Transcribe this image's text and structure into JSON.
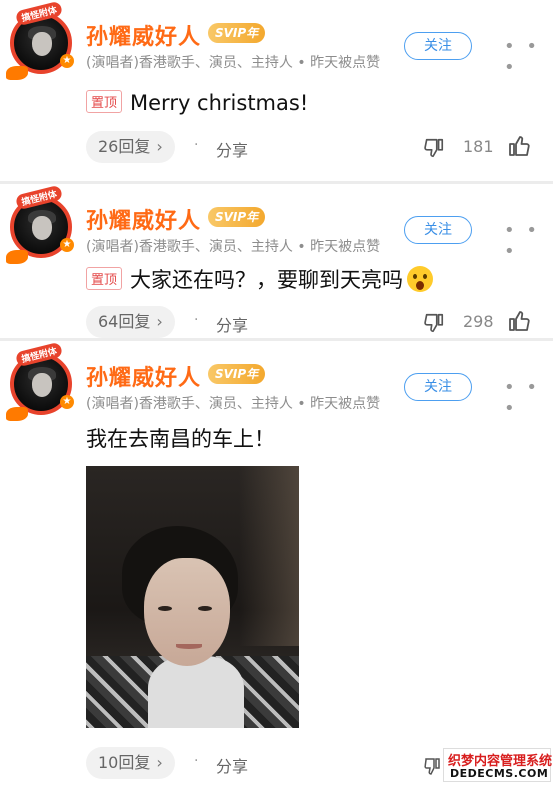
{
  "posts": [
    {
      "avatar_ribbon": "搞怪附体",
      "name": "孙耀威好人",
      "vip_badge": "SVIP年",
      "meta": "(演唱者)香港歌手、演员、主持人 • 昨天被点赞",
      "follow_label": "关注",
      "more_label": "• • •",
      "pin_label": "置顶",
      "text": "Merry christmas!",
      "reply_label": "26回复",
      "share_label": "分享",
      "like_count": "181"
    },
    {
      "avatar_ribbon": "搞怪附体",
      "name": "孙耀威好人",
      "vip_badge": "SVIP年",
      "meta": "(演唱者)香港歌手、演员、主持人 • 昨天被点赞",
      "follow_label": "关注",
      "more_label": "• • •",
      "pin_label": "置顶",
      "text": "大家还在吗？，要聊到天亮吗",
      "emoji": "surprised-face-emoji",
      "reply_label": "64回复",
      "share_label": "分享",
      "like_count": "298"
    },
    {
      "avatar_ribbon": "搞怪附体",
      "name": "孙耀威好人",
      "vip_badge": "SVIP年",
      "meta": "(演唱者)香港歌手、演员、主持人 • 昨天被点赞",
      "follow_label": "关注",
      "more_label": "• • •",
      "text": "我在去南昌的车上！",
      "image": "selfie-photo",
      "reply_label": "10回复",
      "share_label": "分享"
    }
  ],
  "watermark": {
    "line1": "织梦内容管理系统",
    "line2": "DEDECMS.COM"
  },
  "colors": {
    "name": "#ff6a15",
    "follow": "#3a8fe6",
    "pin": "#e44a4a",
    "vip": "#f3a82e"
  }
}
